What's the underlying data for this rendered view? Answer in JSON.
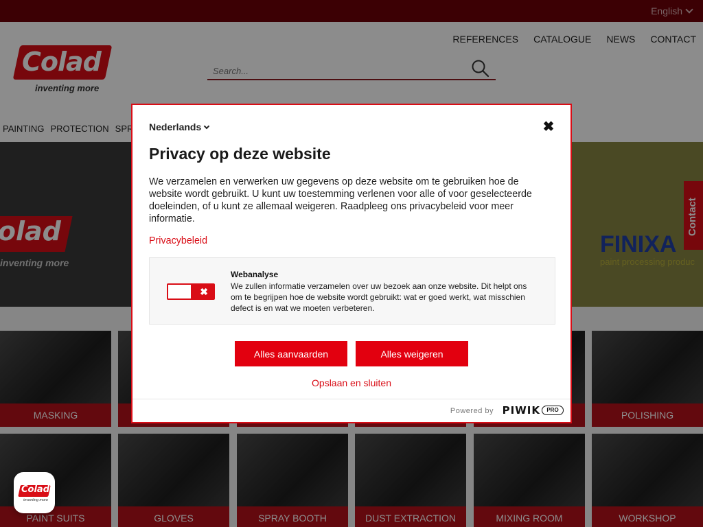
{
  "topbar": {
    "language": "English"
  },
  "header": {
    "logo_text": "Colad",
    "logo_tagline": "inventing more",
    "search_placeholder": "Search...",
    "nav": [
      "REFERENCES",
      "CATALOGUE",
      "NEWS",
      "CONTACT"
    ],
    "categories": [
      "PAINTING",
      "PROTECTION",
      "SPRAY"
    ]
  },
  "hero": {
    "logo_text": "olad",
    "tagline": "inventing more",
    "brand": "FINIXA",
    "brand_sub": "paint processing produc"
  },
  "contact_tab": "Contact",
  "tiles_row1": [
    "MASKING",
    "",
    "",
    "",
    "",
    "POLISHING"
  ],
  "tiles_row2": [
    "PAINT SUITS",
    "GLOVES",
    "SPRAY BOOTH",
    "DUST EXTRACTION",
    "MIXING ROOM",
    "WORKSHOP"
  ],
  "modal": {
    "language": "Nederlands",
    "close_symbol": "✖",
    "title": "Privacy op deze website",
    "description": "We verzamelen en verwerken uw gegevens op deze website om te gebruiken hoe de website wordt gebruikt. U kunt uw toestemming verlenen voor alle of voor geselecteerde doeleinden, of u kunt ze allemaal weigeren. Raadpleeg ons privacybeleid voor meer informatie.",
    "policy_link": "Privacybeleid",
    "consent": {
      "title": "Webanalyse",
      "text": "We zullen informatie verzamelen over uw bezoek aan onze website. Dit helpt ons om te begrijpen hoe de website wordt gebruikt: wat er goed werkt, wat misschien defect is en wat we moeten verbeteren.",
      "toggle_symbol": "✖",
      "enabled": false
    },
    "accept_all": "Alles aanvaarden",
    "reject_all": "Alles weigeren",
    "save_close": "Opslaan en sluiten",
    "powered_by": "Powered by",
    "piwik": "PIWIK",
    "pro": "PRO"
  },
  "badge": {
    "logo_text": "Colad",
    "tagline": "inventing more"
  },
  "colors": {
    "brand_red": "#d90d16",
    "topbar": "#6e0008",
    "tile_label": "#b5121b"
  }
}
